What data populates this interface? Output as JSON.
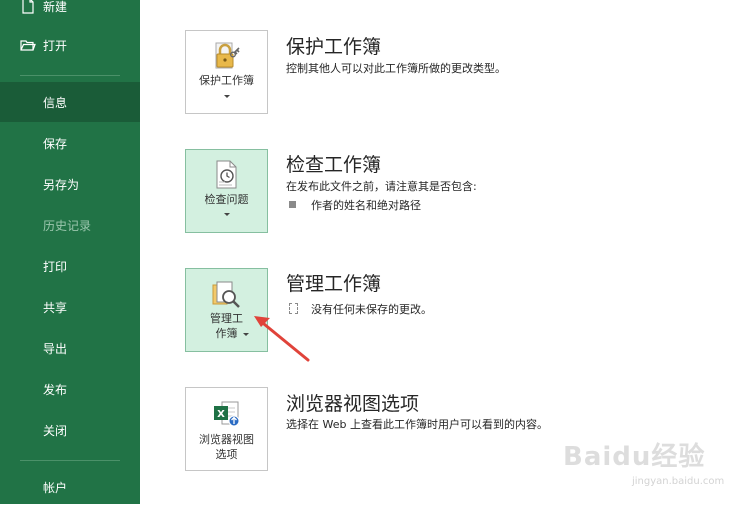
{
  "sidebar": {
    "new_label": "新建",
    "open_label": "打开",
    "items": [
      {
        "label": "信息"
      },
      {
        "label": "保存"
      },
      {
        "label": "另存为"
      },
      {
        "label": "历史记录"
      },
      {
        "label": "打印"
      },
      {
        "label": "共享"
      },
      {
        "label": "导出"
      },
      {
        "label": "发布"
      },
      {
        "label": "关闭"
      }
    ],
    "account_label": "帐户"
  },
  "sections": {
    "protect": {
      "tile_label": "保护工作簿",
      "title": "保护工作簿",
      "description": "控制其他人可以对此工作簿所做的更改类型。"
    },
    "inspect": {
      "tile_label": "检查问题",
      "title": "检查工作簿",
      "description": "在发布此文件之前，请注意其是否包含:",
      "bullet": "作者的姓名和绝对路径"
    },
    "manage": {
      "tile_label_line1": "管理工",
      "tile_label_line2": "作簿",
      "title": "管理工作簿",
      "description": "没有任何未保存的更改。"
    },
    "browser": {
      "tile_label_line1": "浏览器视图",
      "tile_label_line2": "选项",
      "title": "浏览器视图选项",
      "description": "选择在 Web 上查看此工作簿时用户可以看到的内容。"
    }
  },
  "watermark": {
    "text": "Baidu经验",
    "sub": "jingyan.baidu.com"
  },
  "colors": {
    "sidebar_bg": "#217346",
    "sidebar_active": "#1a5c38",
    "tile_highlight": "#d3f0e0",
    "arrow": "#e0433a"
  }
}
